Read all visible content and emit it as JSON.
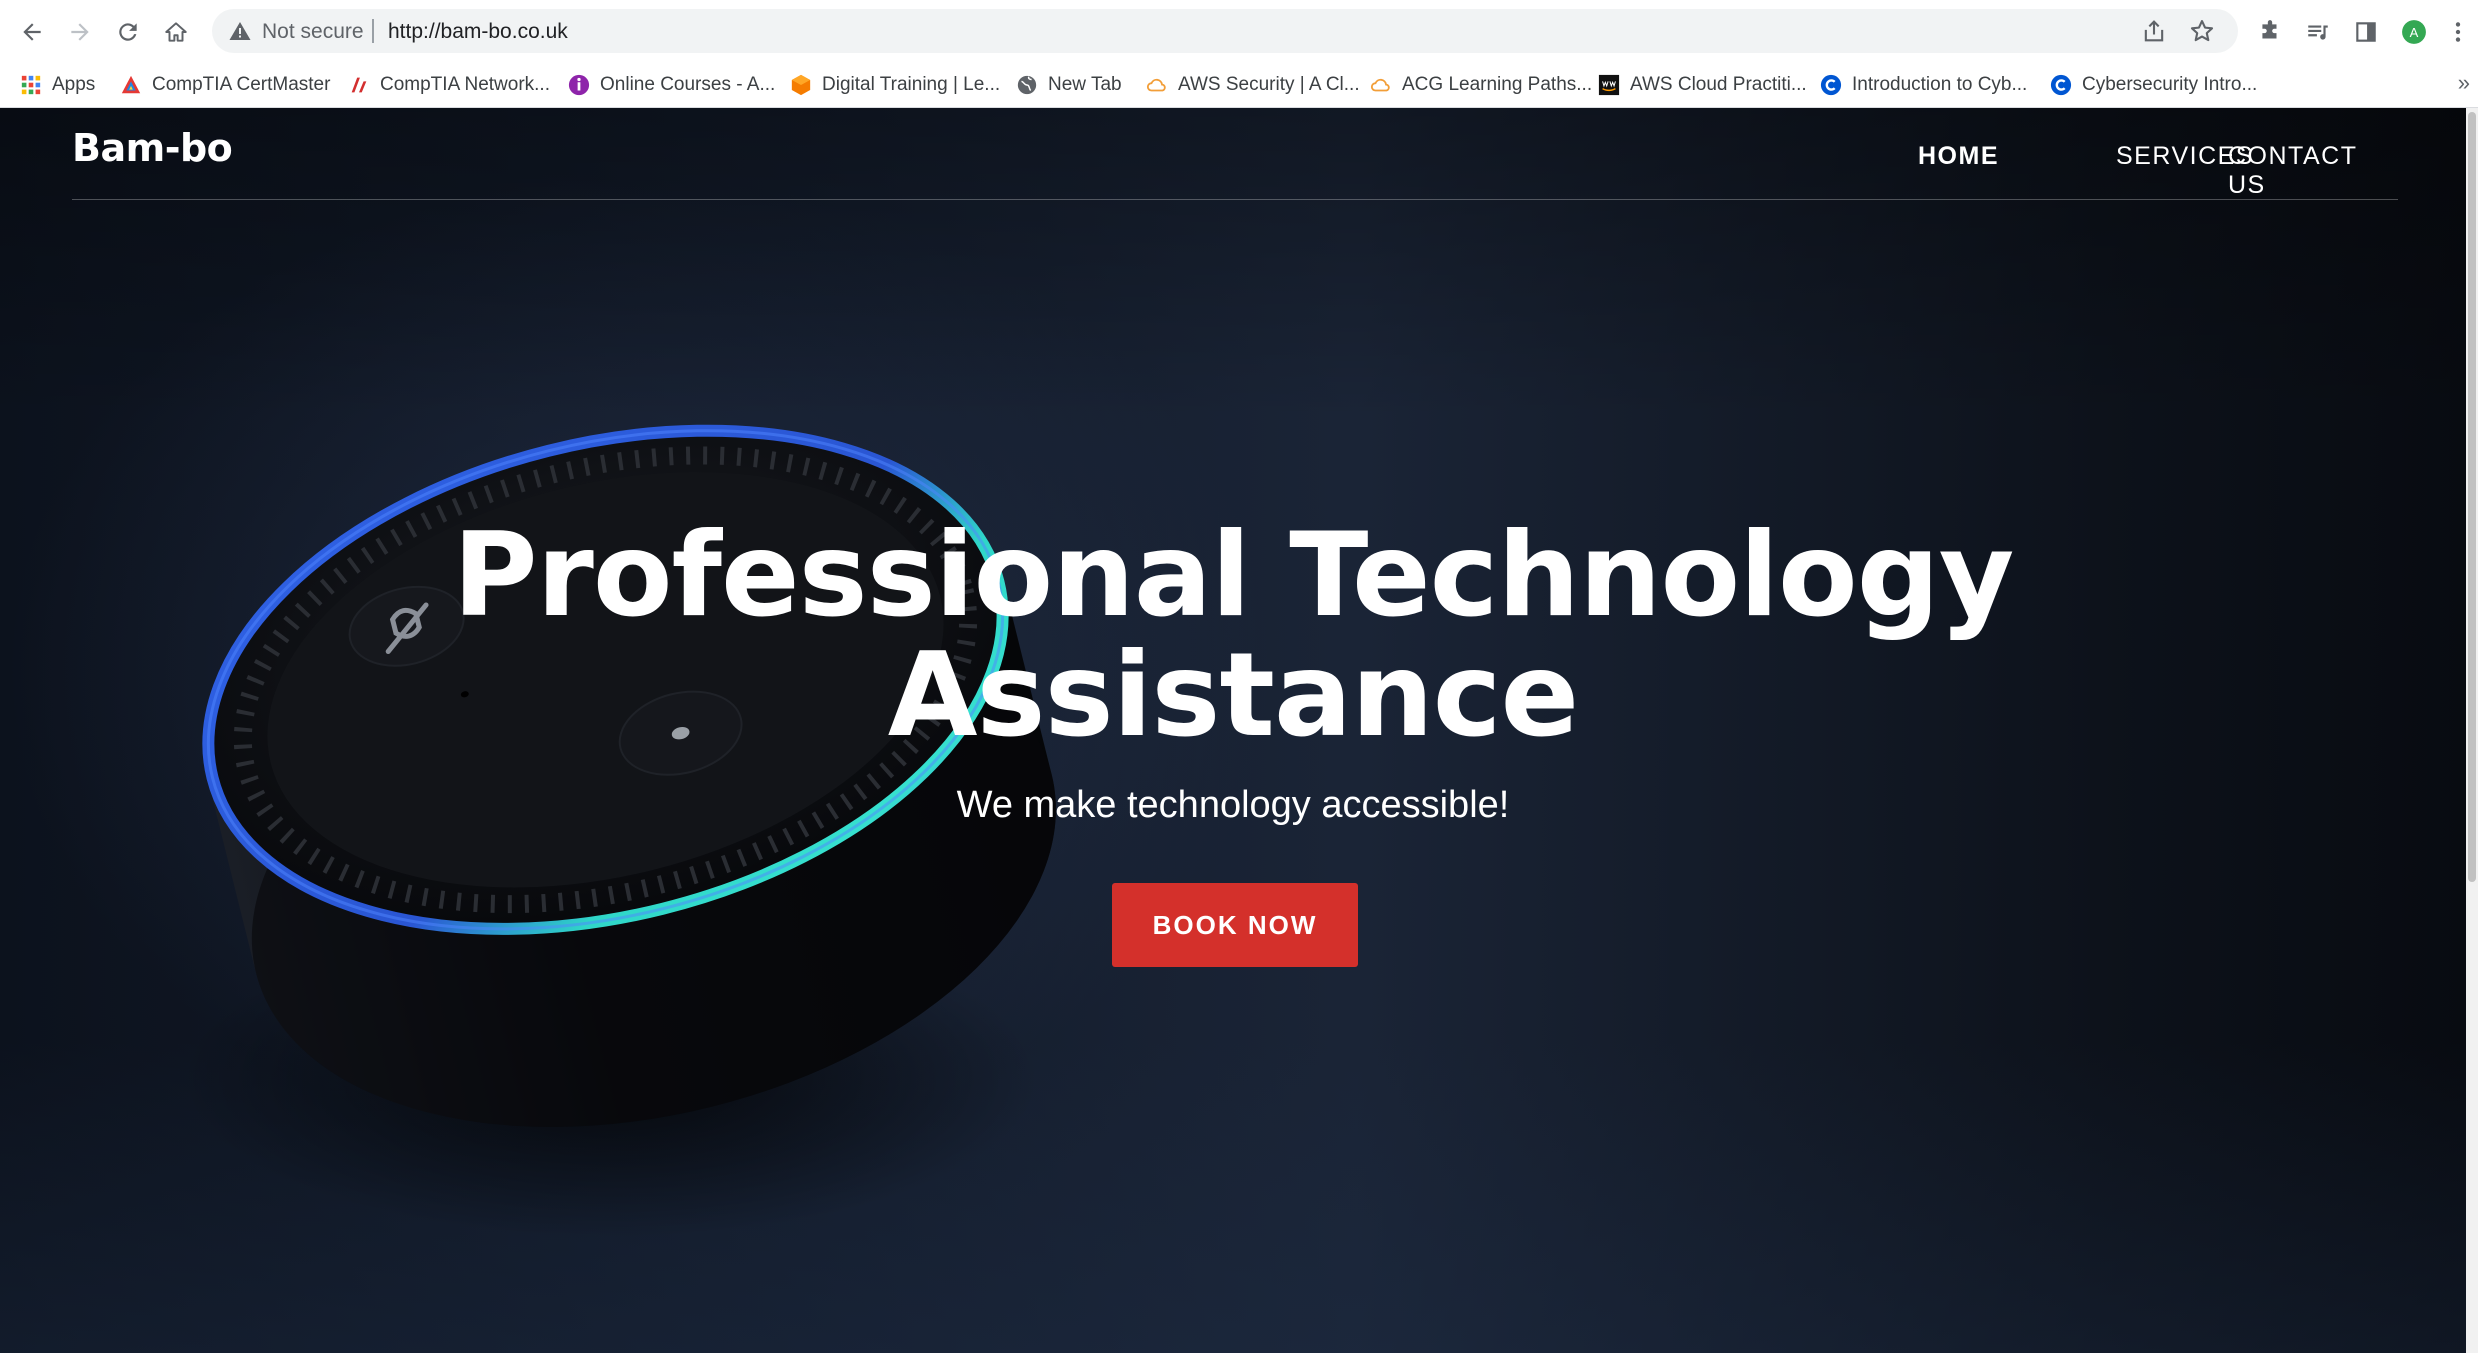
{
  "browser": {
    "security_label": "Not secure",
    "url": "http://bam-bo.co.uk",
    "profile_initial": "A",
    "profile_color": "#34a853"
  },
  "bookmarks": [
    {
      "label": "Apps",
      "icon": "apps-grid-icon"
    },
    {
      "label": "CompTIA CertMaster",
      "icon": "comptia-icon"
    },
    {
      "label": "CompTIA Network...",
      "icon": "comptia-network-icon"
    },
    {
      "label": "Online Courses - A...",
      "icon": "online-courses-icon"
    },
    {
      "label": "Digital Training | Le...",
      "icon": "digital-training-icon"
    },
    {
      "label": "New Tab",
      "icon": "globe-icon"
    },
    {
      "label": "AWS Security | A Cl...",
      "icon": "acg-cloud-icon"
    },
    {
      "label": "ACG Learning Paths...",
      "icon": "acg-cloud-icon"
    },
    {
      "label": "AWS Cloud Practiti...",
      "icon": "aws-icon"
    },
    {
      "label": "Introduction to Cyb...",
      "icon": "coursera-icon"
    },
    {
      "label": "Cybersecurity Intro...",
      "icon": "coursera-icon"
    }
  ],
  "site": {
    "logo": "Bam-bo",
    "nav": {
      "home": "HOME",
      "services": "SERVICES",
      "contact": "CONTACT US"
    },
    "hero": {
      "title_line1": "Professional Technology",
      "title_line2": "Assistance",
      "subtitle": "We make technology accessible!",
      "cta": "BOOK NOW"
    }
  },
  "colors": {
    "cta": "#d4302b",
    "echo_ring": "#2a5bd7",
    "echo_ring_glow": "#2fd6c8"
  }
}
